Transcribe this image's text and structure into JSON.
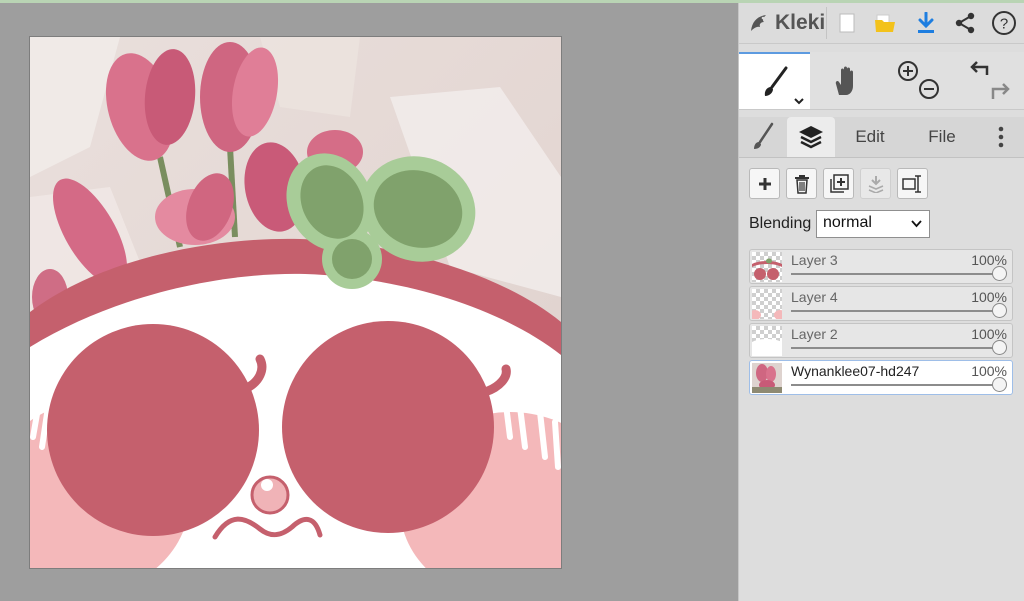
{
  "app": {
    "name": "Kleki"
  },
  "header": {
    "logo_label": "Kleki",
    "icons": [
      "new-image-icon",
      "open-folder-icon",
      "download-icon",
      "share-icon",
      "help-icon"
    ]
  },
  "tools": [
    "brush",
    "hand",
    "zoom",
    "undo-redo"
  ],
  "tabs": {
    "brush_icon": "brush-icon",
    "layers_icon": "layers-icon",
    "edit": "Edit",
    "file": "File"
  },
  "layer_actions": [
    "add-layer",
    "delete-layer",
    "duplicate-layer",
    "merge-down",
    "rename-layer"
  ],
  "blending": {
    "label": "Blending",
    "value": "normal"
  },
  "layers": [
    {
      "name": "Layer 3",
      "opacity": "100%",
      "opacity_value": 1.0,
      "selected": false
    },
    {
      "name": "Layer 4",
      "opacity": "100%",
      "opacity_value": 1.0,
      "selected": false
    },
    {
      "name": "Layer 2",
      "opacity": "100%",
      "opacity_value": 1.0,
      "selected": false
    },
    {
      "name": "Wynanklee07-hd247",
      "opacity": "100%",
      "opacity_value": 1.0,
      "selected": true
    }
  ],
  "colors": {
    "accent": "#5d9be0",
    "drawing_pink": "#c5606d",
    "drawing_green": "#80a26c",
    "leaf_light": "#a8cc98",
    "cheek_pink": "#f4b8ba"
  }
}
